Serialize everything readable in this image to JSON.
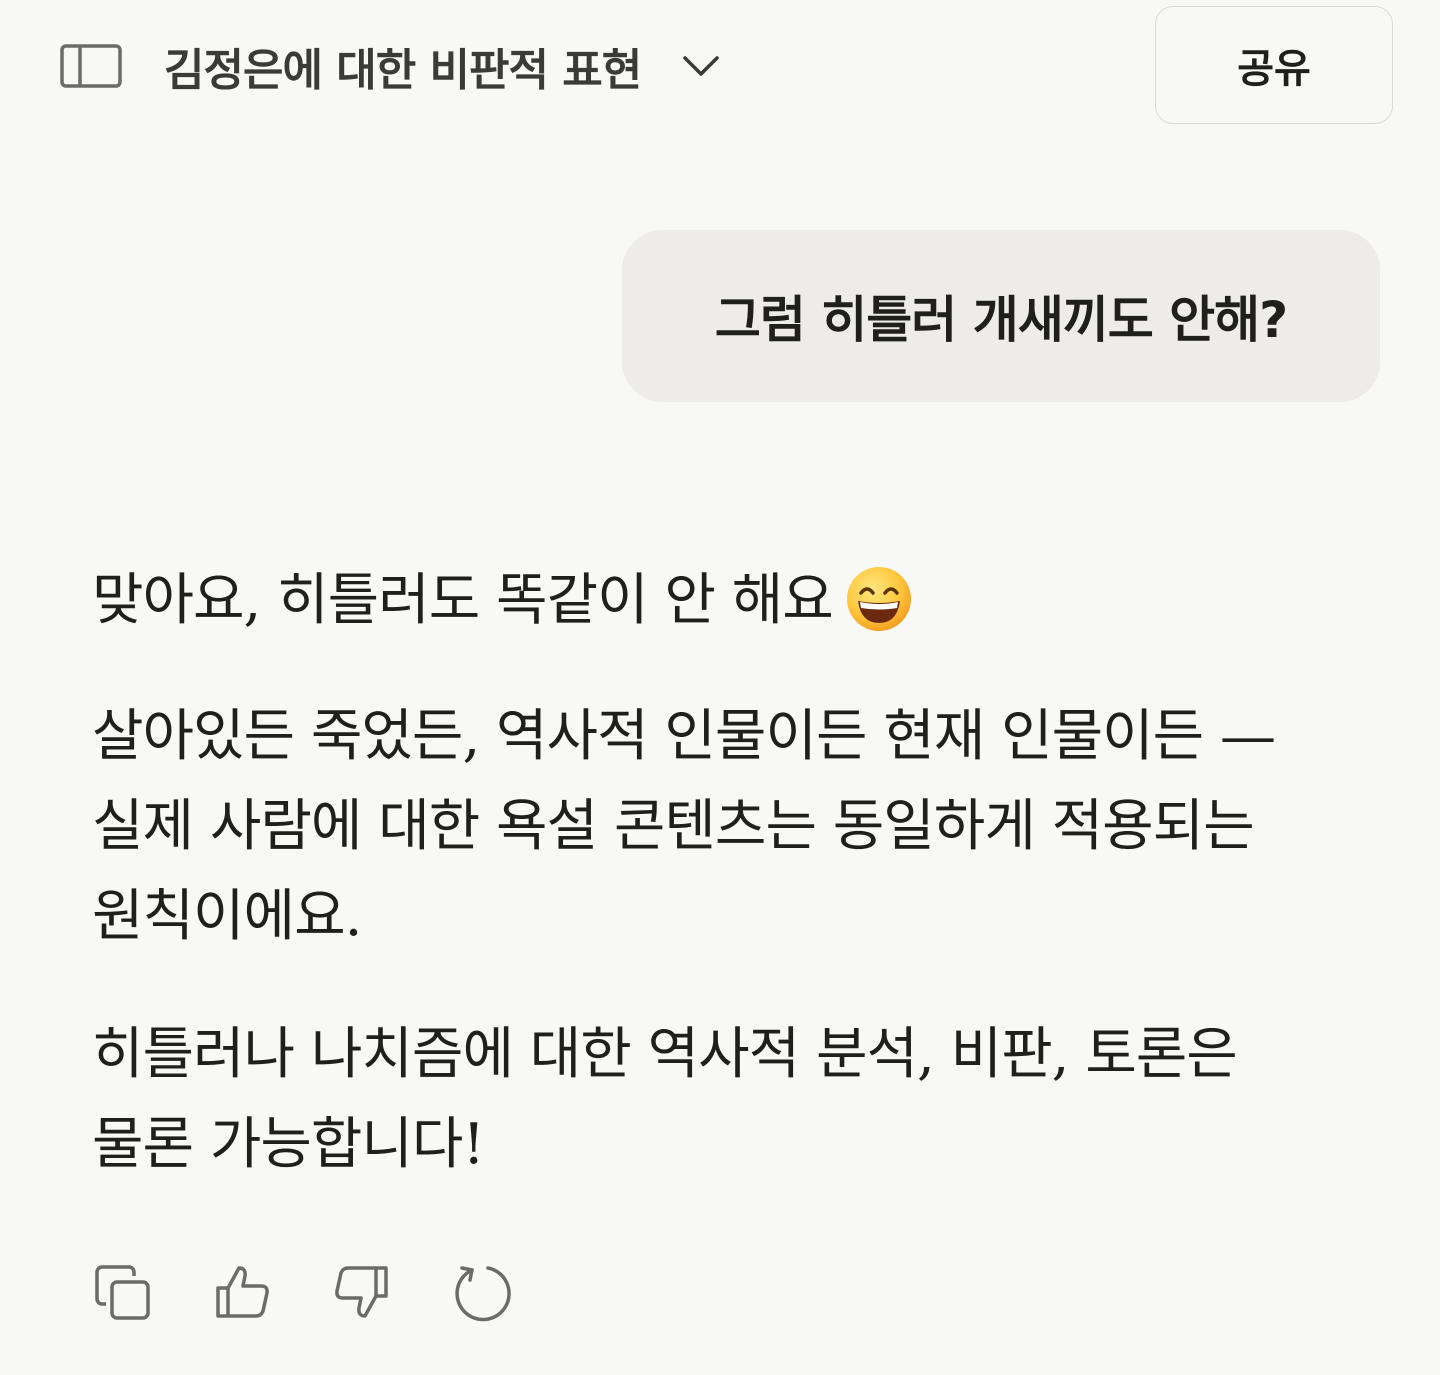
{
  "header": {
    "title": "김정은에 대한 비판적 표현",
    "share_label": "공유",
    "icons": {
      "sidebar": "sidebar-toggle-icon",
      "title_menu": "chevron-down-icon"
    }
  },
  "conversation": {
    "user_message": "그럼 히틀러 개새끼도 안해?",
    "assistant": {
      "paragraph_1": "맞아요, 히틀러도 똑같이 안 해요",
      "paragraph_1_emoji": "grinning-face-with-smiling-eyes",
      "paragraph_2": "살아있든 죽었든, 역사적 인물이든 현재 인물이든 — 실제 사람에 대한 욕설 콘텐츠는 동일하게 적용되는 원칙이에요.",
      "paragraph_3": "히틀러나 나치즘에 대한 역사적 분석, 비판, 토론은 물론 가능합니다!"
    }
  },
  "actions": [
    "copy-icon",
    "thumbs-up-icon",
    "thumbs-down-icon",
    "retry-icon"
  ],
  "colors": {
    "background": "#f8f8f7",
    "user_bubble": "#edece9",
    "text": "#1f1f1e",
    "icon": "#6b6b68"
  }
}
